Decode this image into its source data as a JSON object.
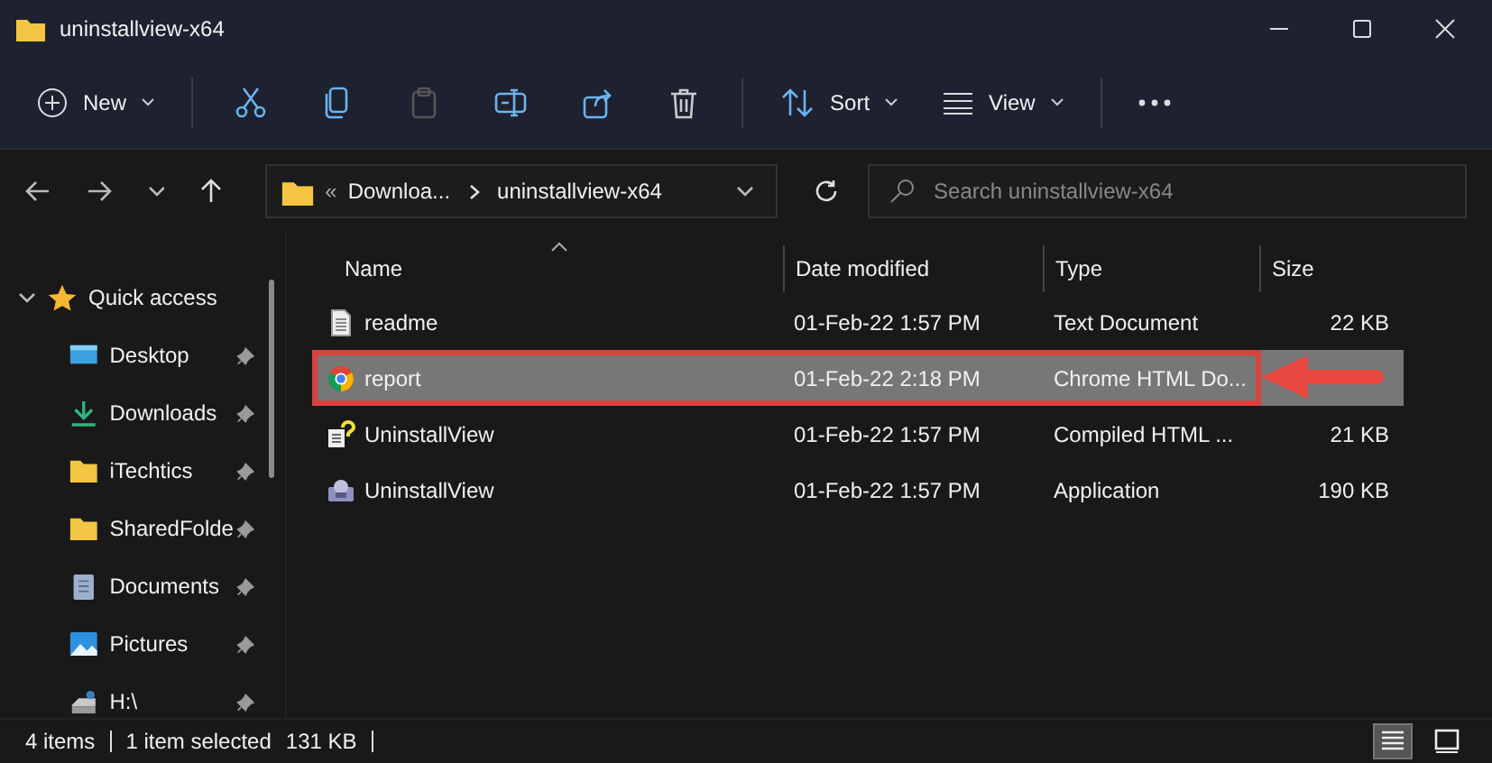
{
  "window": {
    "title": "uninstallview-x64"
  },
  "toolbar": {
    "new": {
      "label": "New"
    },
    "actions": [
      {
        "disabled": false
      },
      {
        "disabled": false
      },
      {
        "disabled": true
      },
      {
        "disabled": false
      },
      {
        "disabled": false
      },
      {
        "disabled": false
      }
    ],
    "sort": {
      "label": "Sort"
    },
    "view": {
      "label": "View"
    }
  },
  "address": {
    "overflow": "«",
    "segments": [
      "Downloa...",
      "uninstallview-x64"
    ]
  },
  "search": {
    "placeholder": "Search uninstallview-x64"
  },
  "sidebar": {
    "items": [
      {
        "label": "Quick access",
        "expanded": true,
        "children": [
          {
            "label": "Desktop",
            "pinned": true
          },
          {
            "label": "Downloads",
            "pinned": true
          },
          {
            "label": "iTechtics",
            "pinned": true
          },
          {
            "label": "SharedFolde",
            "pinned": true
          },
          {
            "label": "Documents",
            "pinned": true
          },
          {
            "label": "Pictures",
            "pinned": true
          },
          {
            "label": "H:\\",
            "pinned": true
          }
        ]
      }
    ]
  },
  "table": {
    "columns": [
      "Name",
      "Date modified",
      "Type",
      "Size"
    ],
    "rows": [
      {
        "name": "readme",
        "date": "01-Feb-22 1:57 PM",
        "type": "Text Document",
        "size": "22 KB",
        "selected": false,
        "annotated": false
      },
      {
        "name": "report",
        "date": "01-Feb-22 2:18 PM",
        "type": "Chrome HTML Do...",
        "selected": true,
        "annotated": true
      },
      {
        "name": "UninstallView",
        "date": "01-Feb-22 1:57 PM",
        "type": "Compiled HTML ...",
        "size": "21 KB",
        "selected": false,
        "annotated": false
      },
      {
        "name": "UninstallView",
        "date": "01-Feb-22 1:57 PM",
        "type": "Application",
        "size": "190 KB",
        "selected": false,
        "annotated": false
      }
    ]
  },
  "status_bar": {
    "items": "4 items",
    "selection": "1 item selected",
    "size": "131 KB"
  },
  "view_toggle": [
    {
      "selected": true
    },
    {
      "selected": false
    }
  ]
}
